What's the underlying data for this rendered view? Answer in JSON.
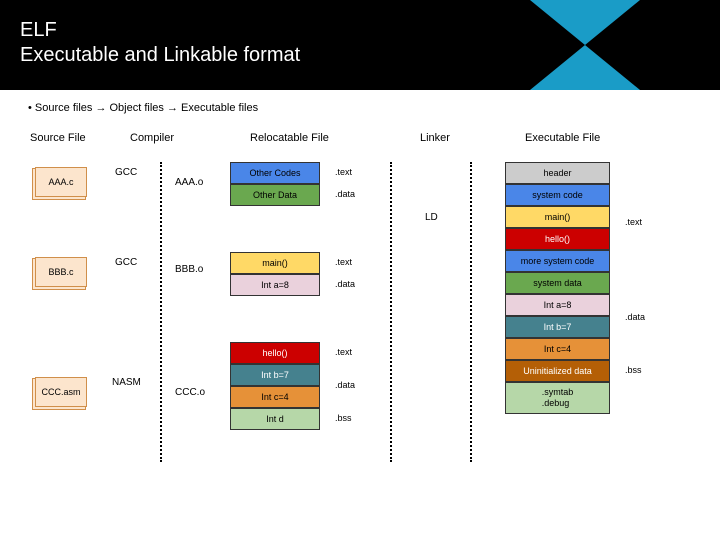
{
  "title_line1": "ELF",
  "title_line2": "Executable and Linkable format",
  "bullet": "Source files → Object files → Executable files",
  "cols": {
    "source": "Source File",
    "compiler": "Compiler",
    "relocatable": "Relocatable File",
    "linker": "Linker",
    "executable": "Executable File"
  },
  "sources": [
    "AAA.c",
    "BBB.c",
    "CCC.asm"
  ],
  "compilers": [
    "GCC",
    "GCC",
    "NASM"
  ],
  "objects": [
    "AAA.o",
    "BBB.o",
    "CCC.o"
  ],
  "reloc": {
    "a": [
      "Other Codes",
      "Other Data"
    ],
    "b": [
      "main()",
      "Int a=8"
    ],
    "c": [
      "hello()",
      "Int b=7",
      "Int c=4",
      "Int d"
    ]
  },
  "segs": {
    "text": ".text",
    "data": ".data",
    "bss": ".bss"
  },
  "ld": "LD",
  "exec": [
    "header",
    "system code",
    "main()",
    "hello()",
    "more system code",
    "system data",
    "Int a=8",
    "Int b=7",
    "Int c=4",
    "Uninitialized data",
    ".symtab\n.debug"
  ],
  "right": {
    "text": ".text",
    "data": ".data",
    "bss": ".bss"
  }
}
